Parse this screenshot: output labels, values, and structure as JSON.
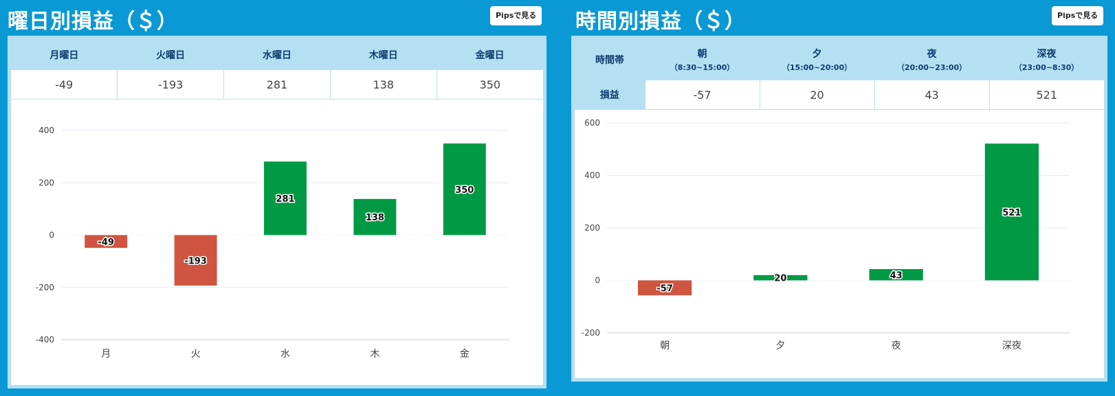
{
  "left": {
    "title": "曜日別損益（＄）",
    "pips_button": "Pipsで見る",
    "headers": [
      "月曜日",
      "火曜日",
      "水曜日",
      "木曜日",
      "金曜日"
    ],
    "values": [
      "-49",
      "-193",
      "281",
      "138",
      "350"
    ]
  },
  "right": {
    "title": "時間別損益（＄）",
    "pips_button": "Pipsで見る",
    "row_header_time": "時間帯",
    "row_header_profit": "損益",
    "periods": [
      {
        "name": "朝",
        "range": "（8:30~15:00）"
      },
      {
        "name": "夕",
        "range": "（15:00~20:00）"
      },
      {
        "name": "夜",
        "range": "（20:00~23:00）"
      },
      {
        "name": "深夜",
        "range": "（23:00~8:30）"
      }
    ],
    "values": [
      "-57",
      "20",
      "43",
      "521"
    ]
  },
  "colors": {
    "background": "#0a99d4",
    "header_bg": "#b4e0f2",
    "positive": "#009a44",
    "negative": "#cf5540",
    "header_text": "#0f3d6e"
  },
  "chart_data": [
    {
      "type": "bar",
      "categories": [
        "月",
        "火",
        "水",
        "木",
        "金"
      ],
      "values": [
        -49,
        -193,
        281,
        138,
        350
      ],
      "yticks": [
        400,
        200,
        0,
        -200,
        -400
      ],
      "ylim": [
        -400,
        400
      ],
      "data_labels": [
        "-49",
        "-193",
        "281",
        "138",
        "350"
      ],
      "title": "",
      "xlabel": "",
      "ylabel": "",
      "grid": true
    },
    {
      "type": "bar",
      "categories": [
        "朝",
        "夕",
        "夜",
        "深夜"
      ],
      "values": [
        -57,
        20,
        43,
        521
      ],
      "yticks": [
        600,
        400,
        200,
        0,
        -200
      ],
      "ylim": [
        -200,
        600
      ],
      "data_labels": [
        "-57",
        "20",
        "43",
        "521"
      ],
      "title": "",
      "xlabel": "",
      "ylabel": "",
      "grid": true
    }
  ]
}
